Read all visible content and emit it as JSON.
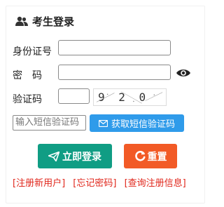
{
  "header": {
    "title": "考生登录",
    "icon": "users-icon"
  },
  "form": {
    "id_label": "身份证号",
    "id_value": "",
    "password_label": "密　码",
    "password_value": "",
    "captcha_label": "验证码",
    "captcha_value": "",
    "captcha_text": "9 2 0 3",
    "sms_placeholder": "输入短信验证码",
    "sms_button": "获取短信验证码"
  },
  "actions": {
    "login": "立即登录",
    "reset": "重置"
  },
  "links": {
    "register": "[注册新用户]",
    "forgot_password": "[忘记密码]",
    "query": "[查询注册信息]"
  },
  "colors": {
    "login": "#109d84",
    "reset": "#f25a26",
    "sms": "#2f9bea",
    "link": "#e0261b"
  }
}
